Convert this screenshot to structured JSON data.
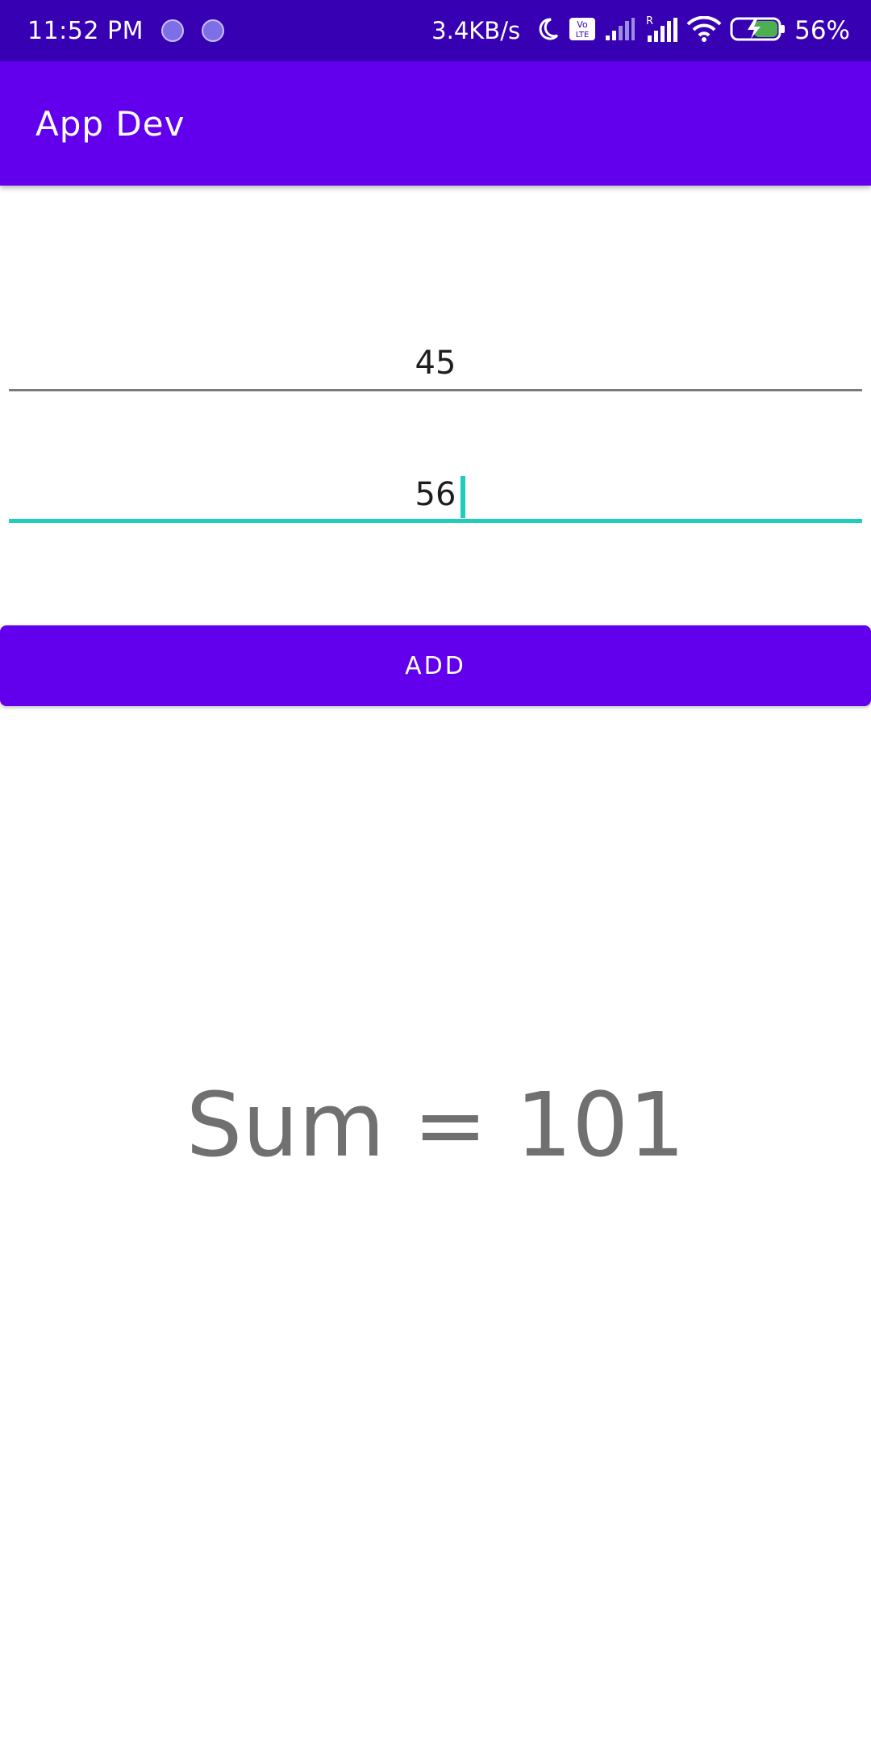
{
  "status_bar": {
    "time": "11:52 PM",
    "net_speed": "3.4KB/s",
    "battery_percent": "56%",
    "icons": [
      "notification-dot-icon",
      "notification-dot-icon",
      "moon-icon",
      "volte-icon",
      "signal-icon",
      "signal-roaming-icon",
      "wifi-icon",
      "battery-charging-icon"
    ]
  },
  "app_bar": {
    "title": "App Dev",
    "color": "#6200ee"
  },
  "form": {
    "first_number": "45",
    "second_number": "56",
    "add_label": "ADD",
    "focus_color": "#1fcdbf"
  },
  "result": {
    "text": "Sum = 101"
  }
}
